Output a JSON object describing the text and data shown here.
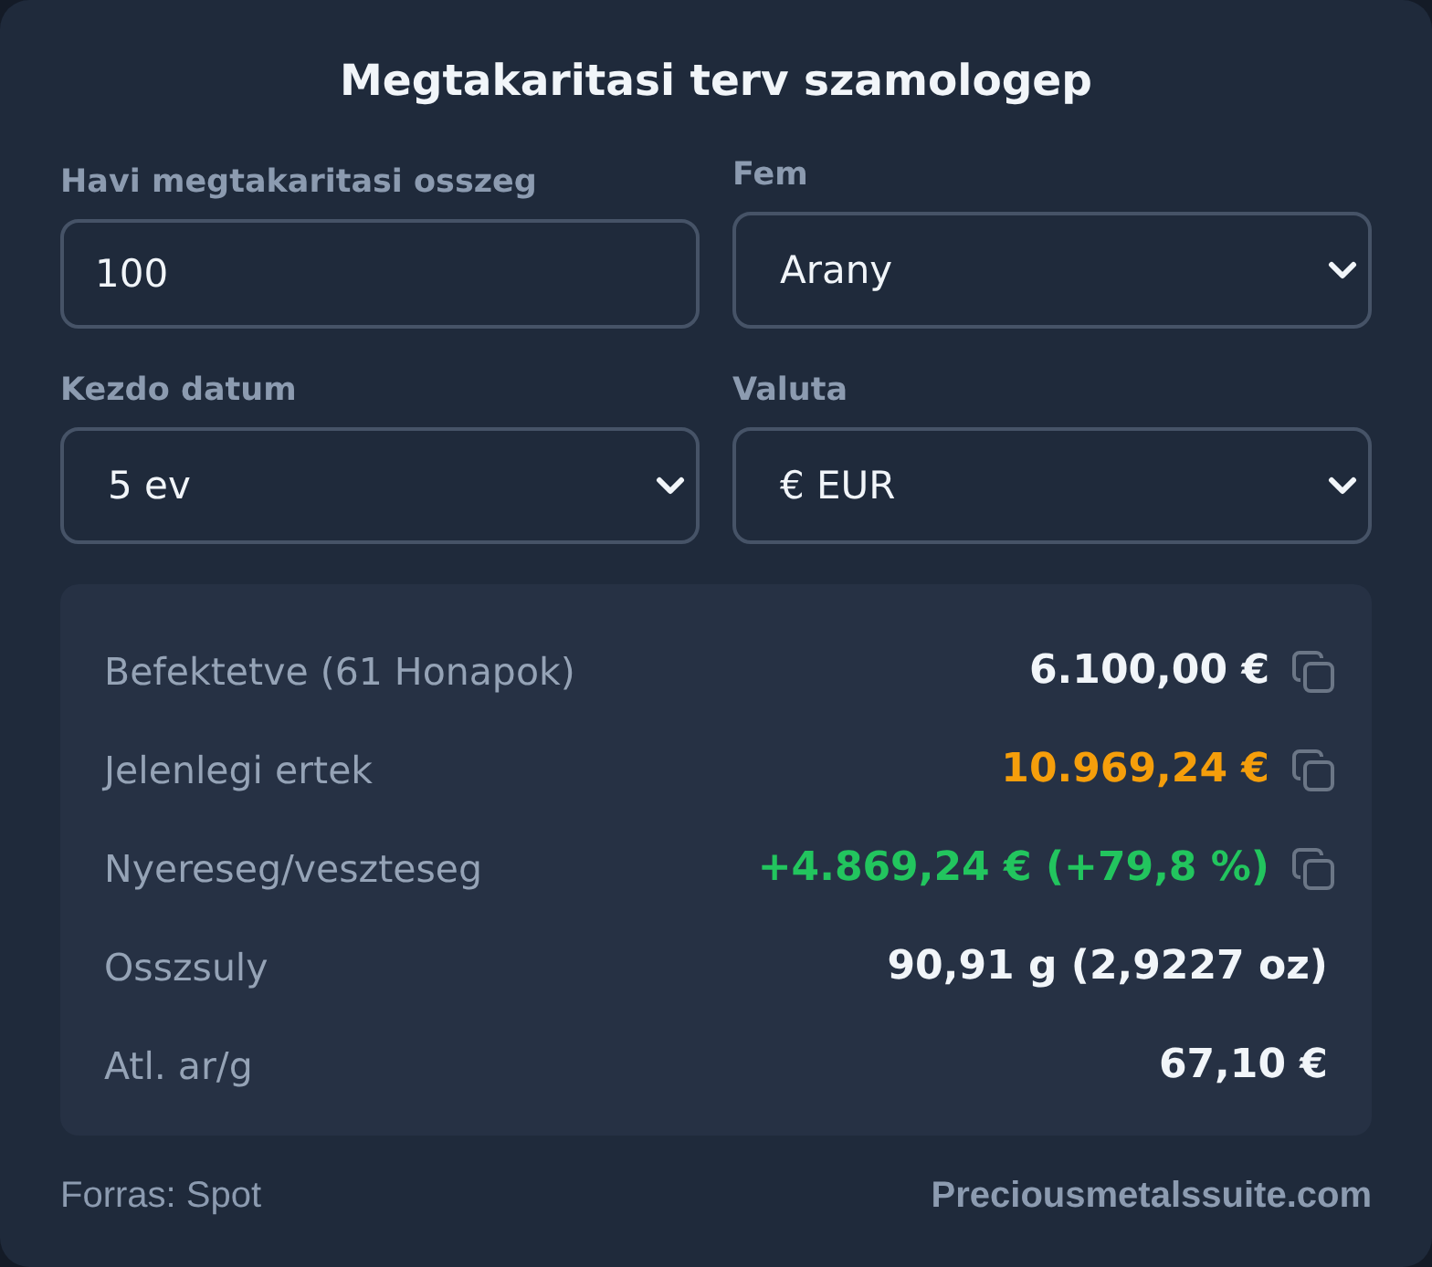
{
  "title": "Megtakaritasi terv szamologep",
  "fields": [
    {
      "kind": "input",
      "label": "Havi megtakaritasi osszeg",
      "value": "100"
    },
    {
      "kind": "select",
      "label": "Fem",
      "value": "Arany"
    },
    {
      "kind": "select",
      "label": "Kezdo datum",
      "value": "5 ev"
    },
    {
      "kind": "select",
      "label": "Valuta",
      "value": "€ EUR"
    }
  ],
  "results": [
    {
      "label": "Befektetve (61 Honapok)",
      "value": "6.100,00 €",
      "color": "#f1f5f9",
      "copyable": true
    },
    {
      "label": "Jelenlegi ertek",
      "value": "10.969,24 €",
      "color": "#f59e0b",
      "copyable": true
    },
    {
      "label": "Nyereseg/veszteseg",
      "value": "+4.869,24 € (+79,8 %)",
      "color": "#22c55e",
      "copyable": true
    },
    {
      "label": "Osszsuly",
      "value": "90,91 g (2,9227 oz)",
      "color": "#f1f5f9",
      "copyable": false
    },
    {
      "label": "Atl. ar/g",
      "value": "67,10 €",
      "color": "#f1f5f9",
      "copyable": false
    }
  ],
  "footer": {
    "source": "Forras: Spot",
    "link": "Preciousmetalssuite.com"
  }
}
